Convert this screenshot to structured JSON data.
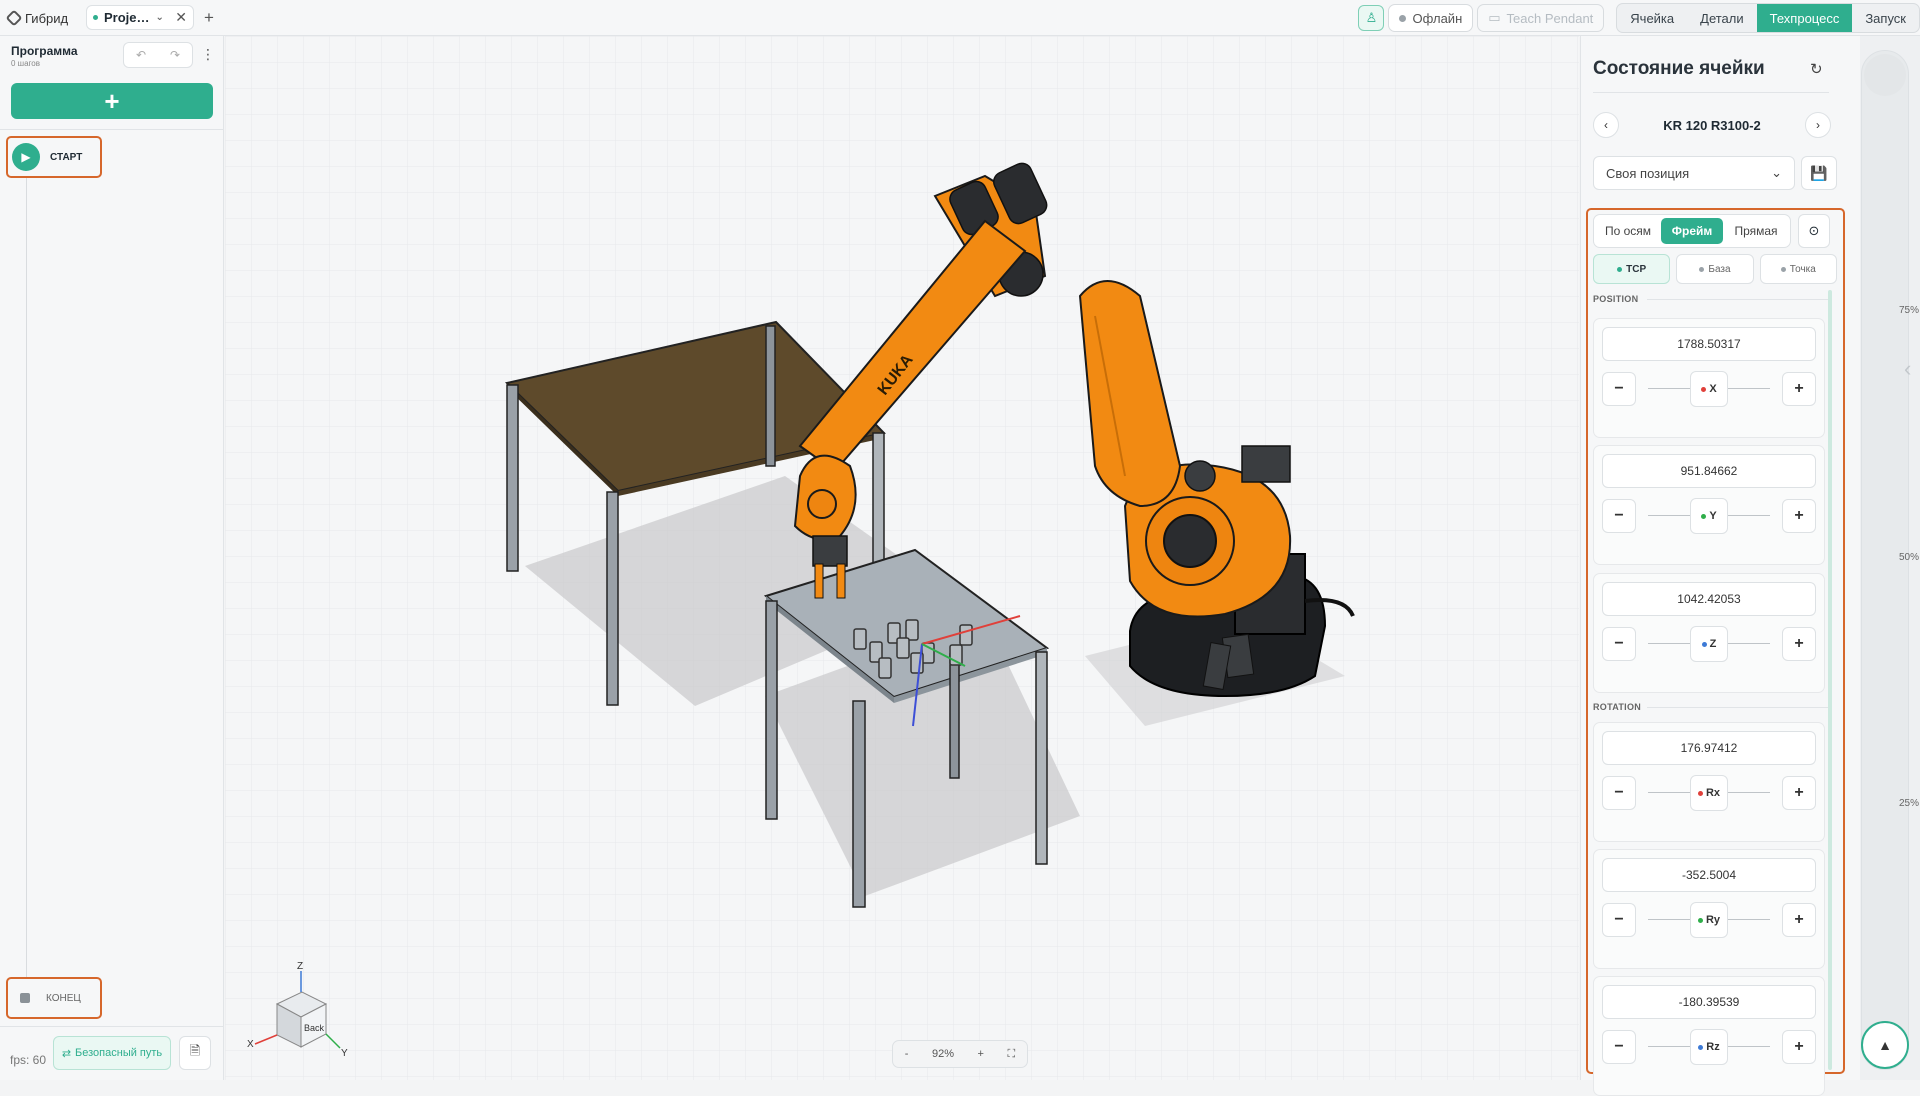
{
  "topbar": {
    "logo": "Гибрид",
    "project_tab": "Proje…",
    "status": "Офлайн",
    "teach_pendant": "Teach Pendant",
    "nav": [
      {
        "label": "Ячейка"
      },
      {
        "label": "Детали"
      },
      {
        "label": "Техпроцесс"
      },
      {
        "label": "Запуск"
      }
    ],
    "active_nav": "Техпроцесс"
  },
  "program": {
    "title": "Программа",
    "steps": "0 шагов",
    "start": "СТАРТ",
    "end": "КОНЕЦ",
    "safe_path": "Безопасный путь",
    "fps": "fps: 60"
  },
  "viewport": {
    "zoom": "92%",
    "zoom_minus": "-",
    "zoom_plus": "+",
    "cube_face": "Back",
    "axes": {
      "x": "X",
      "y": "Y",
      "z": "Z"
    },
    "robot_brand": "KUKA"
  },
  "cell_state": {
    "title": "Состояние ячейки",
    "robot": "KR 120 R3100-2",
    "position": "Своя позиция",
    "modes": [
      {
        "label": "По осям"
      },
      {
        "label": "Фрейм"
      },
      {
        "label": "Прямая"
      }
    ],
    "refs": [
      {
        "label": "TCP"
      },
      {
        "label": "База"
      },
      {
        "label": "Точка"
      }
    ],
    "position_label": "POSITION",
    "rotation_label": "ROTATION",
    "axes": [
      {
        "name": "X",
        "value": "1788.50317",
        "color": "#e0403a"
      },
      {
        "name": "Y",
        "value": "951.84662",
        "color": "#2fae4a"
      },
      {
        "name": "Z",
        "value": "1042.42053",
        "color": "#3d7ad6"
      },
      {
        "name": "Rx",
        "value": "176.97412",
        "color": "#e0403a"
      },
      {
        "name": "Ry",
        "value": "-352.5004",
        "color": "#2fae4a"
      },
      {
        "name": "Rz",
        "value": "-180.39539",
        "color": "#3d7ad6"
      }
    ]
  },
  "speed_slider": {
    "ticks": [
      "75%",
      "50%",
      "25%"
    ]
  },
  "colors": {
    "accent": "#2fae8e",
    "highlight": "#d6672b",
    "robot": "#f28a12"
  }
}
